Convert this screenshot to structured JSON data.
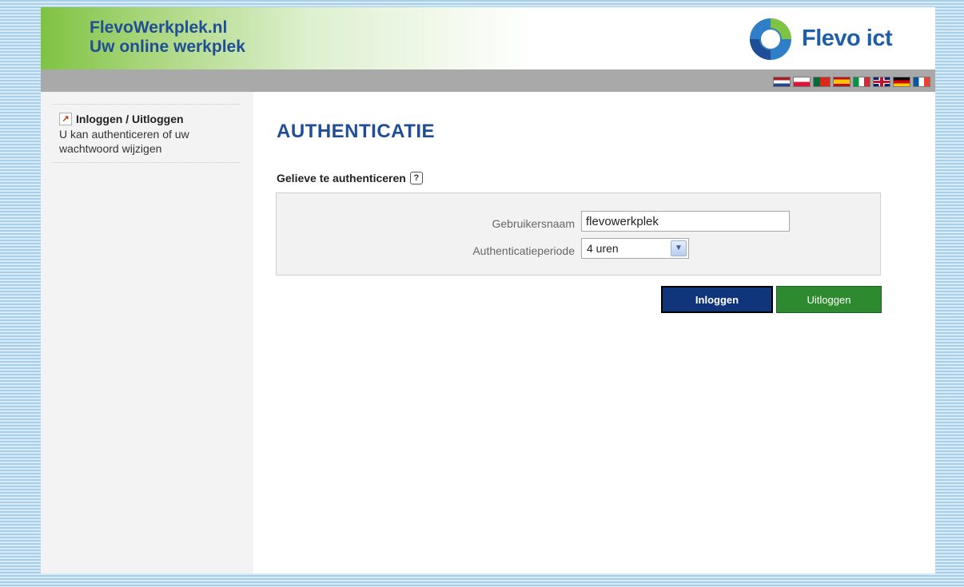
{
  "header": {
    "site_title_line1": "FlevoWerkplek.nl",
    "site_title_line2": "Uw online werkplek",
    "logo_text": "Flevo ict"
  },
  "languages": [
    "Nederlands",
    "Polski",
    "Português",
    "Español",
    "Italiano",
    "English",
    "Deutsch",
    "Français"
  ],
  "sidebar": {
    "items": [
      {
        "title": "Inloggen / Uitloggen",
        "description": "U kan authenticeren of uw wachtwoord wijzigen"
      }
    ]
  },
  "main": {
    "title": "AUTHENTICATIE",
    "subtitle": "Gelieve te authenticeren",
    "help_glyph": "?",
    "form": {
      "username_label": "Gebruikersnaam",
      "username_value": "flevowerkplek",
      "period_label": "Authenticatieperiode",
      "period_value": "4 uren"
    },
    "buttons": {
      "login": "Inloggen",
      "logout": "Uitloggen"
    }
  },
  "colors": {
    "brand_blue": "#1f4e97",
    "header_green": "#7fc342",
    "login_button": "#10357a",
    "logout_button": "#2e8a2e"
  }
}
